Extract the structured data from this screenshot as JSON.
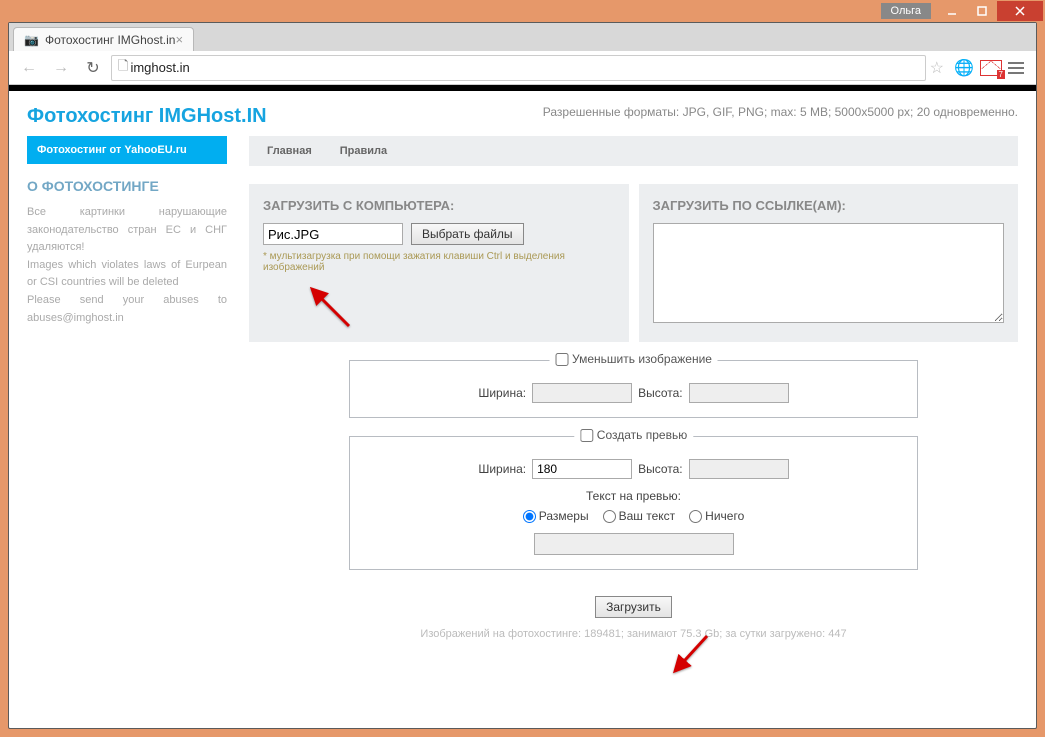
{
  "window": {
    "user": "Ольга"
  },
  "tab": {
    "title": "Фотохостинг IMGhost.in"
  },
  "url": {
    "domain": "imghost.in"
  },
  "toolbar": {
    "gmail_count": "7"
  },
  "page": {
    "logo": "Фотохостинг IMGHost.IN",
    "formats": "Разрешенные форматы: JPG, GIF, PNG; max: 5 MB; 5000x5000 px; 20 одновременно.",
    "sidebar_header": "Фотохостинг от YahooEU.ru",
    "about_heading": "О ФОТОХОСТИНГЕ",
    "about_text": "Все картинки нарушающие законодательство стран ЕС и СНГ удаляются!\nImages which violates laws of Eurpean or CSI countries will be deleted\nPlease send your abuses to abuses@imghost.in",
    "tabs": {
      "home": "Главная",
      "rules": "Правила"
    },
    "upload_pc_heading": "ЗАГРУЗИТЬ С КОМПЬЮТЕРА:",
    "upload_url_heading": "ЗАГРУЗИТЬ ПО ССЫЛКЕ(АМ):",
    "file_value": "Рис.JPG",
    "choose_files": "Выбрать файлы",
    "multiupload_hint": "* мультизагрузка при помощи зажатия клавиши Ctrl и выделения изображений",
    "resize_legend": "Уменьшить изображение",
    "width_label": "Ширина:",
    "height_label": "Высота:",
    "preview_legend": "Создать превью",
    "preview_width_value": "180",
    "preview_text_label": "Текст на превью:",
    "radio_sizes": "Размеры",
    "radio_yourtext": "Ваш текст",
    "radio_nothing": "Ничего",
    "submit": "Загрузить",
    "footer": "Изображений на фотохостинге: 189481; занимают 75.3 Gb; за сутки загружено: 447"
  }
}
